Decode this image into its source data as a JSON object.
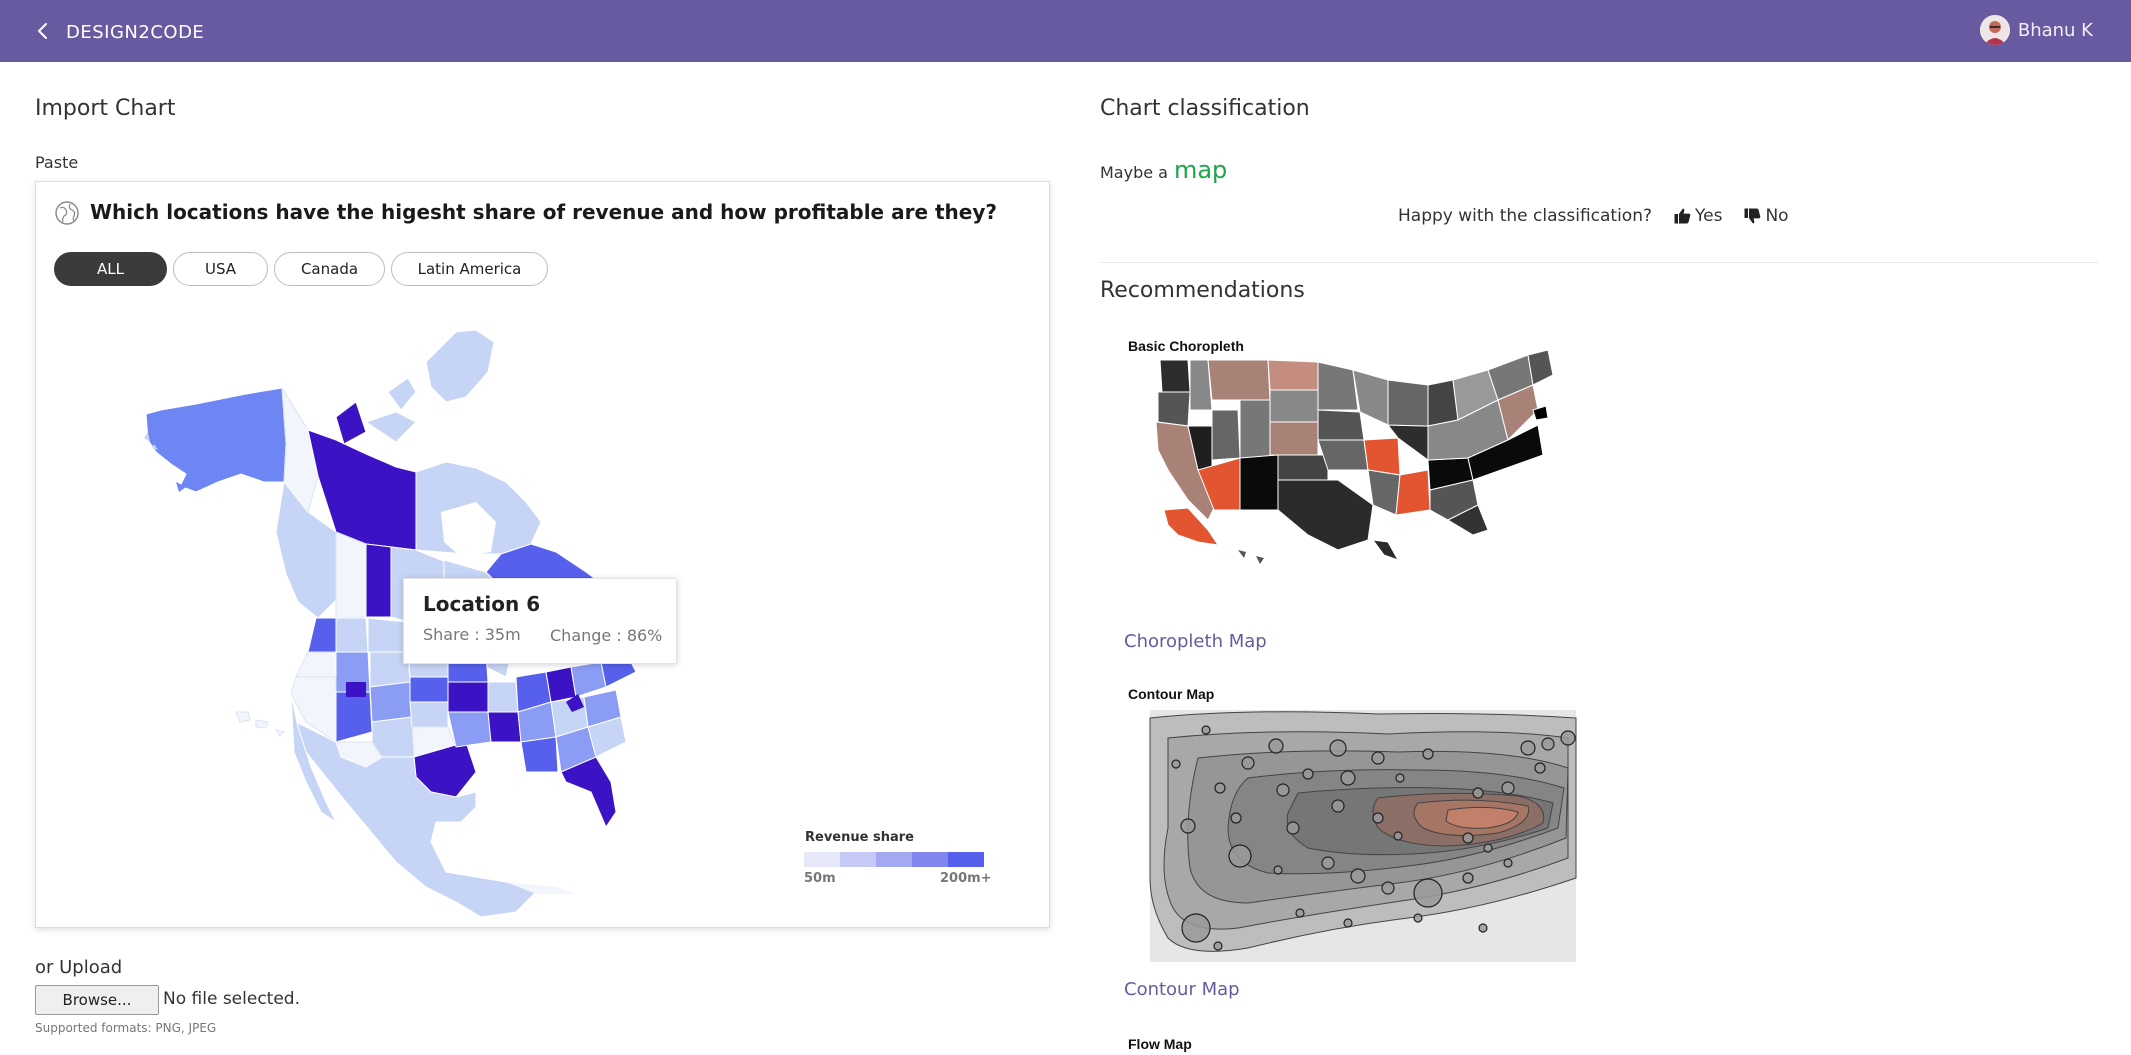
{
  "header": {
    "app_title": "DESIGN2CODE",
    "user_name": "Bhanu K"
  },
  "import": {
    "title": "Import Chart",
    "paste_label": "Paste",
    "upload_label": "or Upload",
    "browse_label": "Browse...",
    "no_file_text": "No file selected.",
    "formats_text": "Supported formats: PNG, JPEG"
  },
  "pasted_chart": {
    "question": "Which locations have the higesht share of revenue and how profitable are they?",
    "filters": [
      {
        "label": "ALL",
        "active": true
      },
      {
        "label": "USA",
        "active": false
      },
      {
        "label": "Canada",
        "active": false
      },
      {
        "label": "Latin America",
        "active": false
      }
    ],
    "tooltip": {
      "title": "Location 6",
      "share": "Share : 35m",
      "change": "Change : 86%"
    },
    "legend": {
      "title": "Revenue share",
      "min_label": "50m",
      "max_label": "200m+",
      "colors": [
        "#e8e8fb",
        "#c6c9f5",
        "#a3a8f1",
        "#8186ee",
        "#5660ec"
      ]
    }
  },
  "classification": {
    "title": "Chart classification",
    "maybe_prefix": "Maybe a",
    "type": "map",
    "happy_question": "Happy with the classification?",
    "yes_label": "Yes",
    "no_label": "No"
  },
  "recommendations": {
    "title": "Recommendations",
    "items": [
      {
        "thumb_title": "Basic Choropleth",
        "label": "Choropleth Map"
      },
      {
        "thumb_title": "Contour Map",
        "label": "Contour Map"
      },
      {
        "thumb_title": "Flow Map",
        "label": ""
      }
    ]
  },
  "colors": {
    "brand": "#675aa0",
    "success": "#1aa84a",
    "map_dark": "#3b12c4",
    "map_mid": "#5660ec",
    "map_light": "#c6d4f5"
  }
}
